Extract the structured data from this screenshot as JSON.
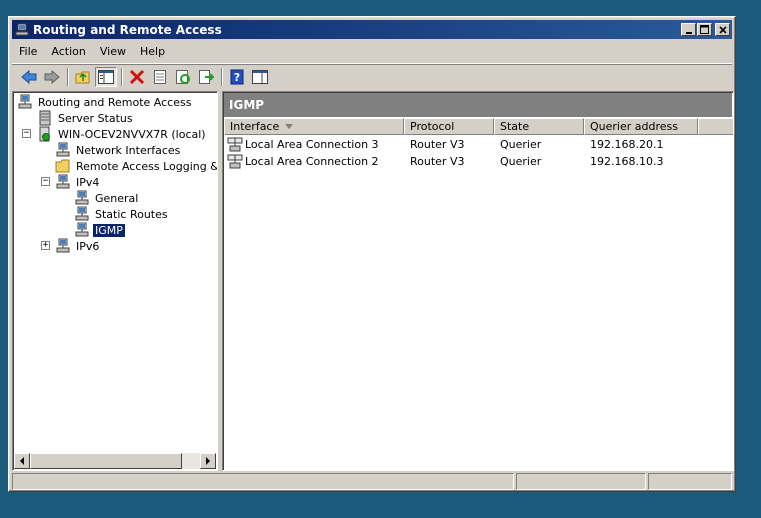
{
  "window": {
    "title": "Routing and Remote Access"
  },
  "menu": [
    {
      "label": "File"
    },
    {
      "label": "Action"
    },
    {
      "label": "View"
    },
    {
      "label": "Help"
    }
  ],
  "toolbar": [
    {
      "icon": "back-arrow-icon"
    },
    {
      "icon": "forward-arrow-icon"
    },
    {
      "icon": "up-folder-icon"
    },
    {
      "icon": "show-hide-tree-icon"
    },
    {
      "icon": "delete-icon"
    },
    {
      "icon": "properties-icon"
    },
    {
      "icon": "refresh-icon"
    },
    {
      "icon": "export-list-icon"
    },
    {
      "icon": "help-icon"
    },
    {
      "icon": "action-pane-icon"
    }
  ],
  "tree": [
    {
      "label": "Routing and Remote Access",
      "icon": "rras-icon",
      "selected": false
    },
    {
      "label": "Server Status",
      "icon": "server-status-icon",
      "selected": false
    },
    {
      "label": "WIN-OCEV2NVVX7R (local)",
      "icon": "server-icon",
      "selected": false,
      "expander": "−"
    },
    {
      "label": "Network Interfaces",
      "icon": "network-interfaces-icon",
      "selected": false
    },
    {
      "label": "Remote Access Logging & Pol",
      "icon": "folder-icon",
      "selected": false
    },
    {
      "label": "IPv4",
      "icon": "router-icon",
      "selected": false,
      "expander": "−"
    },
    {
      "label": "General",
      "icon": "router-icon",
      "selected": false
    },
    {
      "label": "Static Routes",
      "icon": "router-icon",
      "selected": false
    },
    {
      "label": "IGMP",
      "icon": "router-icon",
      "selected": true
    },
    {
      "label": "IPv6",
      "icon": "router-icon",
      "selected": false,
      "expander": "+"
    }
  ],
  "result": {
    "header": "IGMP",
    "columns": [
      {
        "label": "Interface",
        "sorted": true
      },
      {
        "label": "Protocol"
      },
      {
        "label": "State"
      },
      {
        "label": "Querier address"
      }
    ],
    "rows": [
      {
        "interface": "Local Area Connection 3",
        "protocol": "Router V3",
        "state": "Querier",
        "querier": "192.168.20.1"
      },
      {
        "interface": "Local Area Connection 2",
        "protocol": "Router V3",
        "state": "Querier",
        "querier": "192.168.10.3"
      }
    ]
  },
  "colors": {
    "titlebar": "#0a246a",
    "selection": "#0a246a",
    "result_header": "#808080"
  }
}
